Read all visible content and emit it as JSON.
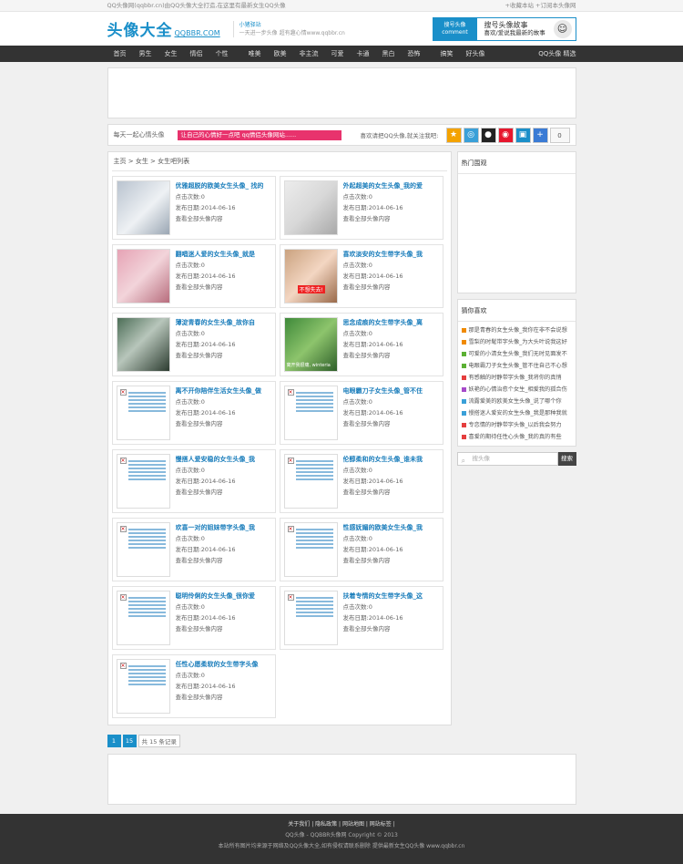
{
  "topbar": {
    "left": "QQ头像网(qqbbr.cn)由QQ头像大全打造,在这里有最新女生QQ头像",
    "right": "+收藏本站 +订阅本头像网"
  },
  "header": {
    "logo_cn": "头像大全",
    "logo_en": "QQBBR.COM",
    "slogan_1": "小猪驿站",
    "slogan_2": "一天进一步头像 超有趣心情www.qqbbr.cn",
    "banner_badge_1": "搜号头像",
    "banner_badge_2": "comment",
    "banner_title": "搜号头像故事",
    "banner_sub": "喜欢/爱说我最新的故事",
    "banner_emoji": "☺"
  },
  "nav": {
    "items": [
      "首页",
      "男生",
      "女生",
      "情侣",
      "个性"
    ],
    "items2": [
      "唯美",
      "欧美",
      "非主流",
      "可爱",
      "卡通",
      "黑白",
      "恐怖"
    ],
    "items3": [
      "搞笑",
      "好头像"
    ],
    "right": "QQ头像 精选"
  },
  "share": {
    "left": "每天一起心情头像",
    "marquee": "让自己的心情好一点吧 qq情侣头像网站......",
    "label": "喜欢请把QQ头像,就关注我吧:",
    "count": "0",
    "icons": [
      {
        "name": "star-icon",
        "glyph": "★",
        "color": "#f4a300"
      },
      {
        "name": "chat-icon",
        "glyph": "◎",
        "color": "#3aa0d8"
      },
      {
        "name": "penguin-icon",
        "glyph": "●",
        "color": "#222222"
      },
      {
        "name": "weibo-icon",
        "glyph": "◉",
        "color": "#e6162d"
      },
      {
        "name": "renren-icon",
        "glyph": "▣",
        "color": "#1a8fc9"
      },
      {
        "name": "plus-icon",
        "glyph": "+",
        "color": "#3a7bd5"
      }
    ]
  },
  "breadcrumb": "主页 > 女生 > 女生吧列表",
  "cards": [
    {
      "title": "优雅超脱的欧美女生头像_ 找的",
      "clicks": "点击次数:0",
      "date": "发布日期:2014-06-16",
      "more": "查看全部头像内容",
      "img": "photo",
      "bg": "linear-gradient(135deg,#b9c3cf,#eef1f4 55%,#9aa6b3)"
    },
    {
      "title": "外起超美的女生头像_我的爱",
      "clicks": "点击次数:0",
      "date": "发布日期:2014-06-16",
      "more": "查看全部头像内容",
      "img": "photo",
      "bg": "linear-gradient(135deg,#ececec,#d8d8d8 50%,#a9a9a9)"
    },
    {
      "title": "翻唱迷人爱的女生头像_就是",
      "clicks": "点击次数:0",
      "date": "发布日期:2014-06-16",
      "more": "查看全部头像内容",
      "img": "photo",
      "bg": "linear-gradient(135deg,#e6a3b5,#f2d4da 50%,#b86d7d)"
    },
    {
      "title": "喜欢淡安的女生带字头像_我",
      "clicks": "点击次数:0",
      "date": "发布日期:2014-06-16",
      "more": "查看全部头像内容",
      "img": "photo",
      "bg": "linear-gradient(135deg,#caa27f,#f3d6c2 50%,#9a6a4a)",
      "tag": "不想失去!"
    },
    {
      "title": "薄淀青春的女生头像_故你自",
      "clicks": "点击次数:0",
      "date": "发布日期:2014-06-16",
      "more": "查看全部头像内容",
      "img": "photo",
      "bg": "linear-gradient(135deg,#4c6e57,#b8c6bb 45%,#2c3c30)"
    },
    {
      "title": "思念成痕的女生带字头像_离",
      "clicks": "点击次数:0",
      "date": "发布日期:2014-06-16",
      "more": "查看全部头像内容",
      "img": "photo",
      "bg": "linear-gradient(135deg,#3f8a3a,#8dc46c 50%,#2e5f29)",
      "tag2": "离开我很痛, winteria"
    },
    {
      "title": "离不开你陪伴生活女生头像_做",
      "clicks": "点击次数:0",
      "date": "发布日期:2014-06-16",
      "more": "查看全部头像内容",
      "img": "ph"
    },
    {
      "title": "电眼霸刀子女生头像_管不住",
      "clicks": "点击次数:0",
      "date": "发布日期:2014-06-16",
      "more": "查看全部头像内容",
      "img": "ph"
    },
    {
      "title": "慢搭人爱安稳的女生头像_我",
      "clicks": "点击次数:0",
      "date": "发布日期:2014-06-16",
      "more": "查看全部头像内容",
      "img": "ph"
    },
    {
      "title": "伦醇柔和的女生头像_谁未我",
      "clicks": "点击次数:0",
      "date": "发布日期:2014-06-16",
      "more": "查看全部头像内容",
      "img": "ph"
    },
    {
      "title": "欢喜一对的姐妹带字头像_我",
      "clicks": "点击次数:0",
      "date": "发布日期:2014-06-16",
      "more": "查看全部头像内容",
      "img": "ph"
    },
    {
      "title": "性感妩媚的欧美女生头像_我",
      "clicks": "点击次数:0",
      "date": "发布日期:2014-06-16",
      "more": "查看全部头像内容",
      "img": "ph"
    },
    {
      "title": "聪明伶俐的女生头像_很你爱",
      "clicks": "点击次数:0",
      "date": "发布日期:2014-06-16",
      "more": "查看全部头像内容",
      "img": "ph"
    },
    {
      "title": "扶着专情的女生带字头像_这",
      "clicks": "点击次数:0",
      "date": "发布日期:2014-06-16",
      "more": "查看全部头像内容",
      "img": "ph"
    },
    {
      "title": "任性心愿柔软的女生带字头像",
      "clicks": "点击次数:0",
      "date": "发布日期:2014-06-16",
      "more": "查看全部头像内容",
      "img": "ph"
    }
  ],
  "pager": {
    "page": "1",
    "total": "15",
    "records": "共 15 条记录"
  },
  "sidebar": {
    "hot_title": "热门围观",
    "rec_title": "猜你喜欢",
    "rec_items": [
      {
        "text": "那是青春的女生头像_我你在非不会说想",
        "color": "#f08a00"
      },
      {
        "text": "雪梨的时髦带字头像_为大头叶说我这好",
        "color": "#f08a00"
      },
      {
        "text": "可爱的小清女生头像_我们无时见面发不",
        "color": "#5bb033"
      },
      {
        "text": "电眼霸刀子女生头像_管不住自己不心想",
        "color": "#5bb033"
      },
      {
        "text": "有感触的时静带字头像_我将你的真悄",
        "color": "#e53e3e"
      },
      {
        "text": "妖艳的心情治愈个女生_相爱我的孤合伤",
        "color": "#a64ac9"
      },
      {
        "text": "流露爱美的欧美女生头像_说了哪个你",
        "color": "#3aa0d8"
      },
      {
        "text": "慢搭迷人爱安的女生头像_我是那种我就",
        "color": "#3aa0d8"
      },
      {
        "text": "专恋情的时静带字头像_以后我会努力",
        "color": "#e53e3e"
      },
      {
        "text": "喜爱的期待任性心头像_我的真的有些",
        "color": "#e53e3e"
      }
    ],
    "search_placeholder": "搜头像",
    "search_btn": "搜索"
  },
  "footer": {
    "links": "关于我们 | 隐私政策 | 网站地图 | 网站标签 |",
    "line2": "QQ头像 - QQBBR头像网 Copyright © 2013",
    "line3": "本站所有图片均来源于网络及QQ头像大全,如有侵权请联系删除 提供最新女生QQ头像 www.qqbbr.cn"
  }
}
